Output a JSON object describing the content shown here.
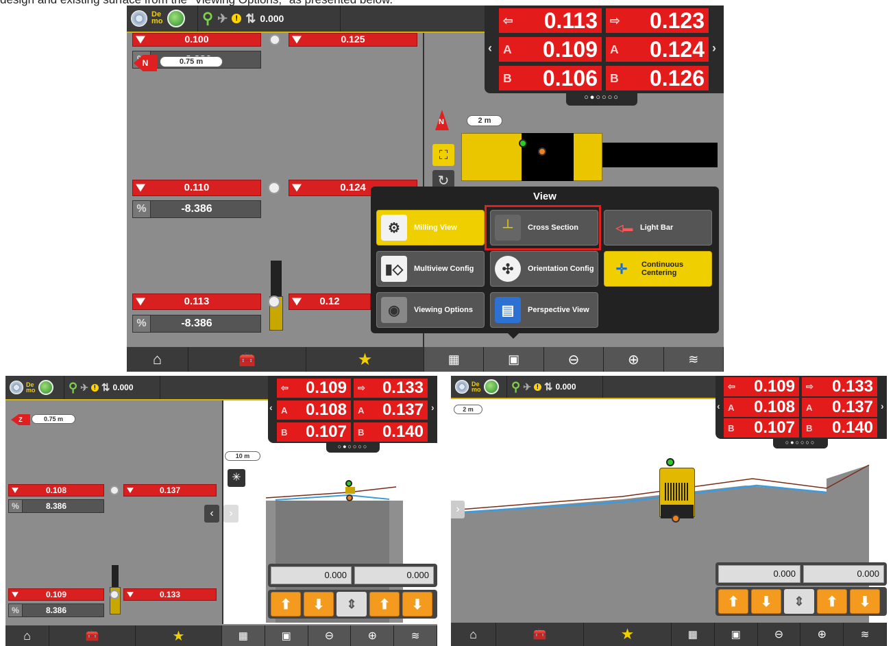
{
  "caption": "design and existing surface from the \"Viewing Options,\" as presented below.",
  "top": {
    "status": {
      "demo_line1": "De",
      "demo_line2": "mo",
      "value": "0.000"
    },
    "readout": {
      "row1_left": "0.113",
      "row1_right": "0.123",
      "row2_left": "0.109",
      "row2_right": "0.124",
      "row3_left": "0.106",
      "row3_right": "0.126",
      "icon_a": "A",
      "icon_b": "B",
      "pager": "○●○○○○"
    },
    "scale_left": "0.75 m",
    "scale_right": "2 m",
    "north": "N",
    "bars": {
      "r1_left": "0.110",
      "r1_right": "0.124",
      "g1": "-8.386",
      "r2_left": "0.113",
      "r2_right": "0.12",
      "g2": "-8.386",
      "r0_left": "0.100",
      "r0_right": "0.125",
      "g0": "-8.386",
      "pct": "%"
    },
    "view_menu": {
      "title": "View",
      "items": [
        {
          "label": "Milling View",
          "icon": "mill-gear-icon",
          "active": true
        },
        {
          "label": "Cross Section",
          "icon": "cross-section-icon",
          "active": false
        },
        {
          "label": "Light Bar",
          "icon": "light-bar-icon",
          "active": false
        },
        {
          "label": "Multiview Config",
          "icon": "multiview-icon",
          "active": false
        },
        {
          "label": "Orientation Config",
          "icon": "compass-icon",
          "active": false
        },
        {
          "label": "Continuous Centering",
          "icon": "centering-icon",
          "active": true
        },
        {
          "label": "Viewing Options",
          "icon": "eye-gear-icon",
          "active": false
        },
        {
          "label": "Perspective View",
          "icon": "perspective-icon",
          "active": false
        }
      ]
    }
  },
  "bottom_left": {
    "status": {
      "demo_line1": "De",
      "demo_line2": "mo",
      "value": "0.000"
    },
    "readout": {
      "row1_left": "0.109",
      "row1_right": "0.133",
      "row2_left": "0.108",
      "row2_right": "0.137",
      "row3_left": "0.107",
      "row3_right": "0.140",
      "icon_a": "A",
      "icon_b": "B",
      "pager": "○●○○○○"
    },
    "scale_left": "0.75 m",
    "scale_right": "10 m",
    "bars": {
      "r1_left": "0.108",
      "r1_right": "0.137",
      "g1": "8.386",
      "r2_left": "0.109",
      "r2_right": "0.133",
      "g2": "8.386",
      "pct": "%"
    },
    "controls": {
      "left_value": "0.000",
      "right_value": "0.000"
    }
  },
  "bottom_right": {
    "status": {
      "demo_line1": "De",
      "demo_line2": "mo",
      "value": "0.000"
    },
    "readout": {
      "row1_left": "0.109",
      "row1_right": "0.133",
      "row2_left": "0.108",
      "row2_right": "0.137",
      "row3_left": "0.107",
      "row3_right": "0.140",
      "icon_a": "A",
      "icon_b": "B",
      "pager": "○●○○○○"
    },
    "scale": "2 m",
    "controls": {
      "left_value": "0.000",
      "right_value": "0.000"
    }
  },
  "colors": {
    "red": "#e31b1b",
    "yellow": "#f0cf00",
    "dark": "#3a3a3a",
    "orange": "#f39a1f"
  }
}
